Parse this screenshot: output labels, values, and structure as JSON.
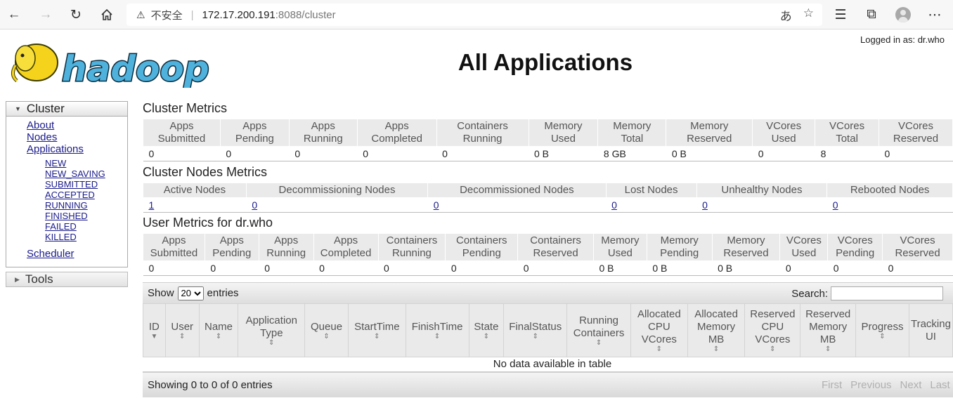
{
  "browser": {
    "insecure_label": "不安全",
    "url_host": "172.17.200.191",
    "url_path": ":8088/cluster"
  },
  "header": {
    "logged_in": "Logged in as: dr.who",
    "title": "All Applications",
    "logo_text": "hadoop"
  },
  "sidebar": {
    "cluster_label": "Cluster",
    "links": [
      "About",
      "Nodes",
      "Applications"
    ],
    "app_states": [
      "NEW",
      "NEW_SAVING",
      "SUBMITTED",
      "ACCEPTED",
      "RUNNING",
      "FINISHED",
      "FAILED",
      "KILLED"
    ],
    "scheduler": "Scheduler",
    "tools_label": "Tools"
  },
  "cluster_metrics": {
    "title": "Cluster Metrics",
    "headers": [
      [
        "Apps",
        "Submitted"
      ],
      [
        "Apps",
        "Pending"
      ],
      [
        "Apps",
        "Running"
      ],
      [
        "Apps",
        "Completed"
      ],
      [
        "Containers",
        "Running"
      ],
      [
        "Memory",
        "Used"
      ],
      [
        "Memory",
        "Total"
      ],
      [
        "Memory",
        "Reserved"
      ],
      [
        "VCores",
        "Used"
      ],
      [
        "VCores",
        "Total"
      ],
      [
        "VCores",
        "Reserved"
      ]
    ],
    "values": [
      "0",
      "0",
      "0",
      "0",
      "0",
      "0 B",
      "8 GB",
      "0 B",
      "0",
      "8",
      "0"
    ]
  },
  "nodes_metrics": {
    "title": "Cluster Nodes Metrics",
    "headers": [
      "Active Nodes",
      "Decommissioning Nodes",
      "Decommissioned Nodes",
      "Lost Nodes",
      "Unhealthy Nodes",
      "Rebooted Nodes"
    ],
    "values": [
      "1",
      "0",
      "0",
      "0",
      "0",
      "0"
    ]
  },
  "user_metrics": {
    "title": "User Metrics for dr.who",
    "headers": [
      [
        "Apps",
        "Submitted"
      ],
      [
        "Apps",
        "Pending"
      ],
      [
        "Apps",
        "Running"
      ],
      [
        "Apps",
        "Completed"
      ],
      [
        "Containers",
        "Running"
      ],
      [
        "Containers",
        "Pending"
      ],
      [
        "Containers",
        "Reserved"
      ],
      [
        "Memory",
        "Used"
      ],
      [
        "Memory",
        "Pending"
      ],
      [
        "Memory",
        "Reserved"
      ],
      [
        "VCores",
        "Used"
      ],
      [
        "VCores",
        "Pending"
      ],
      [
        "VCores",
        "Reserved"
      ]
    ],
    "values": [
      "0",
      "0",
      "0",
      "0",
      "0",
      "0",
      "0",
      "0 B",
      "0 B",
      "0 B",
      "0",
      "0",
      "0"
    ]
  },
  "apps_table": {
    "show_label": "Show",
    "entries_value": "20",
    "entries_label": "entries",
    "search_label": "Search:",
    "columns": [
      "ID",
      "User",
      "Name",
      "Application Type",
      "Queue",
      "StartTime",
      "FinishTime",
      "State",
      "FinalStatus",
      "Running Containers",
      "Allocated CPU VCores",
      "Allocated Memory MB",
      "Reserved CPU VCores",
      "Reserved Memory MB",
      "Progress",
      "Tracking UI"
    ],
    "empty_message": "No data available in table",
    "info": "Showing 0 to 0 of 0 entries",
    "pager": [
      "First",
      "Previous",
      "Next",
      "Last"
    ]
  }
}
